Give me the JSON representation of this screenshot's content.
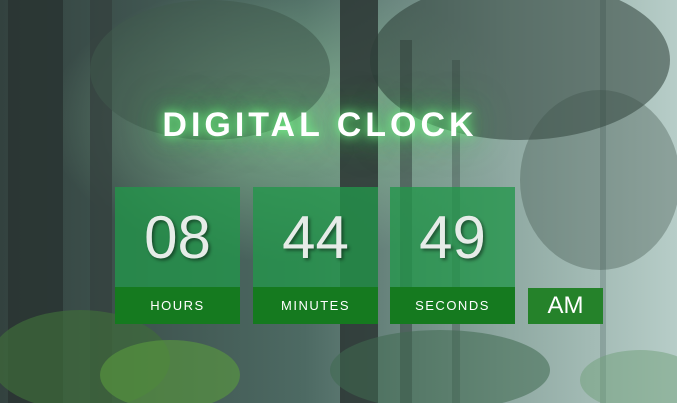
{
  "app": {
    "title": "DIGITAL CLOCK"
  },
  "clock": {
    "hours": "08",
    "minutes": "44",
    "seconds": "49",
    "period": "AM",
    "labels": {
      "hours": "HOURS",
      "minutes": "MINUTES",
      "seconds": "SECONDS"
    }
  },
  "colors": {
    "tile": "#22964a",
    "label_bar": "#157a1f",
    "period_badge": "#25822a",
    "title_glow": "#50e064"
  }
}
